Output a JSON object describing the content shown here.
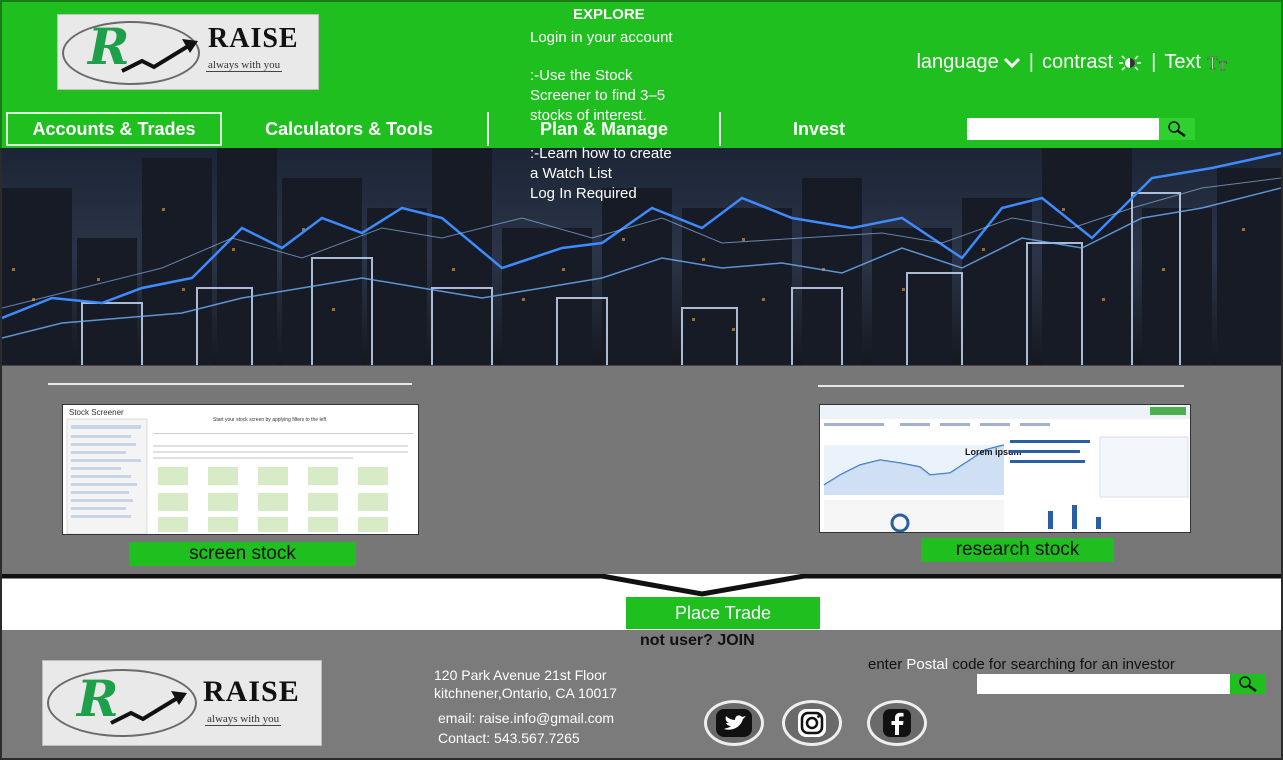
{
  "brand": {
    "name": "RAISE",
    "tagline": "always with you",
    "initial": "R"
  },
  "utility": {
    "language": "language",
    "contrast": "contrast",
    "text": "Text"
  },
  "nav": {
    "items": [
      {
        "label": "Accounts & Trades",
        "active": true
      },
      {
        "label": "Calculators & Tools"
      },
      {
        "label": "Plan & Manage"
      },
      {
        "label": "Invest"
      }
    ],
    "search_placeholder": ""
  },
  "explore": {
    "title": "EXPLORE",
    "line1": "Login in your account",
    "line2": ":-Use the Stock\nScreener to find 3–5\nstocks of interest.",
    "line3": ":-Learn how to create\na Watch List\nLog In Required",
    "left_button": "screen stock",
    "right_button": "research stock",
    "left_thumb_title": "Stock Screener",
    "left_thumb_heading": "Start your stock screen by applying filters to the left",
    "right_thumb_label": "Lorem ipsum"
  },
  "cta": {
    "place_trade": "Place Trade",
    "join": "not user? JOIN"
  },
  "footer": {
    "address1": "120 Park Avenue 21st Floor",
    "address2": "kitchnener,Ontario, CA 10017",
    "email": "email:  raise.info@gmail.com",
    "contact": "Contact: 543.567.7265",
    "postal_prefix": "enter ",
    "postal_highlight": "Postal",
    "postal_suffix": " code for searching for an investor"
  },
  "colors": {
    "brand_green": "#1ebf1e",
    "dark_bg": "#2b2b2b",
    "section_gray": "#777777"
  }
}
